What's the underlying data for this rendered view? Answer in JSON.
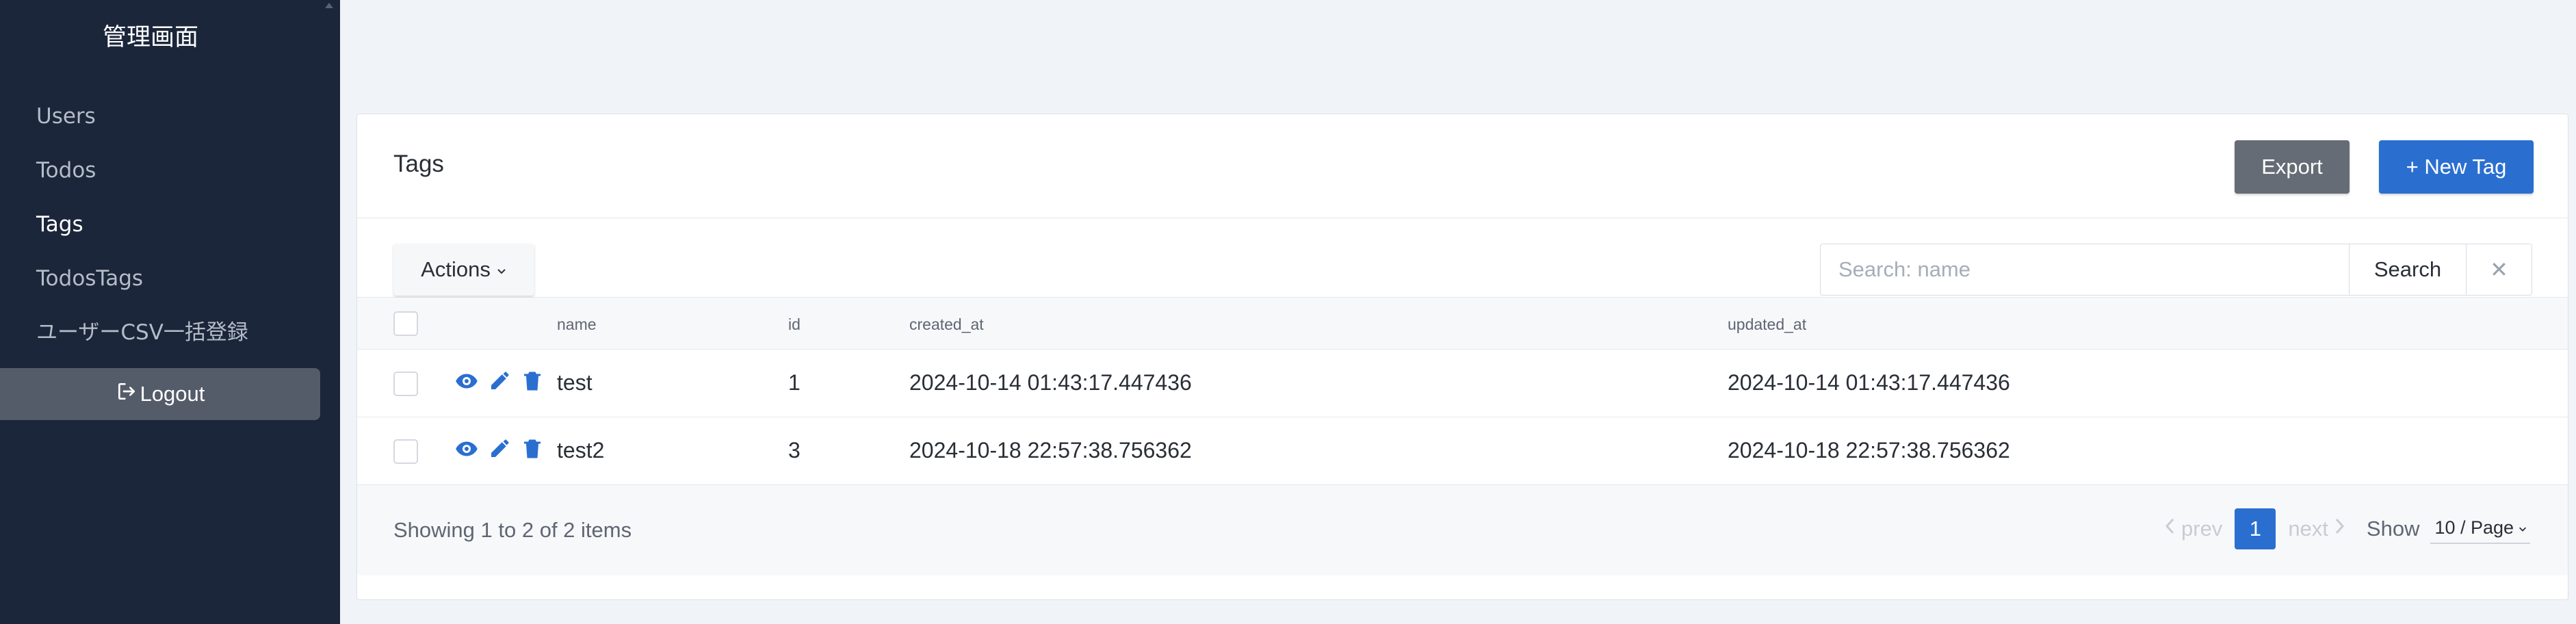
{
  "sidebar": {
    "brand": "管理画面",
    "items": [
      {
        "label": "Users"
      },
      {
        "label": "Todos"
      },
      {
        "label": "Tags"
      },
      {
        "label": "TodosTags"
      },
      {
        "label": "ユーザーCSV一括登録"
      }
    ],
    "logout_label": "Logout"
  },
  "header": {
    "title": "Tags",
    "export_label": "Export",
    "new_label": "+ New Tag"
  },
  "toolbar": {
    "actions_label": "Actions",
    "search_placeholder": "Search: name",
    "search_label": "Search",
    "clear_label": "✕"
  },
  "table": {
    "columns": [
      "name",
      "id",
      "created_at",
      "updated_at"
    ],
    "rows": [
      {
        "name": "test",
        "id": "1",
        "created_at": "2024-10-14 01:43:17.447436",
        "updated_at": "2024-10-14 01:43:17.447436"
      },
      {
        "name": "test2",
        "id": "3",
        "created_at": "2024-10-18 22:57:38.756362",
        "updated_at": "2024-10-18 22:57:38.756362"
      }
    ]
  },
  "footer": {
    "showing": "Showing 1 to 2 of 2 items",
    "prev": "prev",
    "current_page": "1",
    "next": "next",
    "show_label": "Show",
    "per_page": "10 / Page"
  },
  "colors": {
    "sidebar_bg": "#1b263a",
    "accent": "#2a6fd0",
    "export_bg": "#666c75"
  }
}
